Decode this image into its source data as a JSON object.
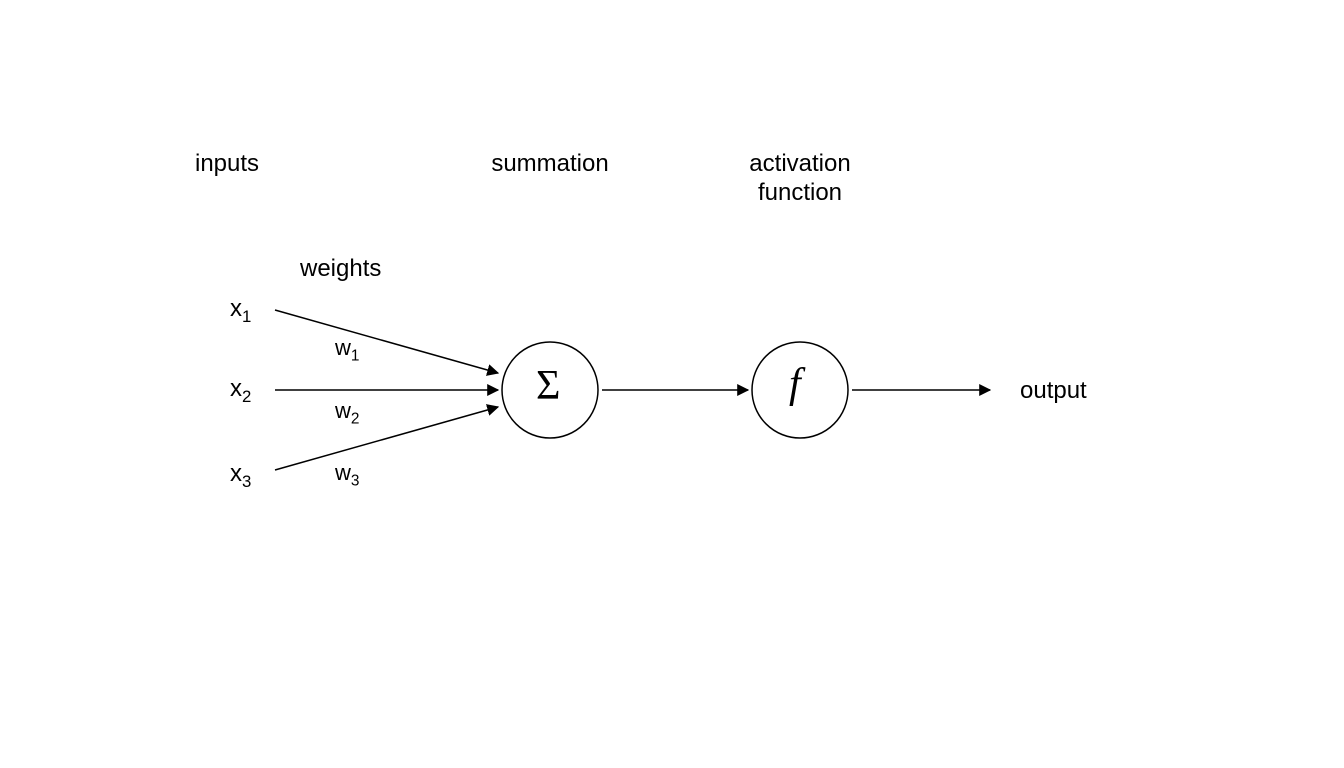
{
  "headers": {
    "inputs": "inputs",
    "summation": "summation",
    "activation_line1": "activation",
    "activation_line2": "function",
    "weights": "weights",
    "output": "output"
  },
  "inputs": {
    "x1_main": "x",
    "x1_sub": "1",
    "x2_main": "x",
    "x2_sub": "2",
    "x3_main": "x",
    "x3_sub": "3"
  },
  "weights": {
    "w1_main": "w",
    "w1_sub": "1",
    "w2_main": "w",
    "w2_sub": "2",
    "w3_main": "w",
    "w3_sub": "3"
  },
  "nodes": {
    "sum_symbol": "Σ",
    "activation_symbol": "f"
  }
}
